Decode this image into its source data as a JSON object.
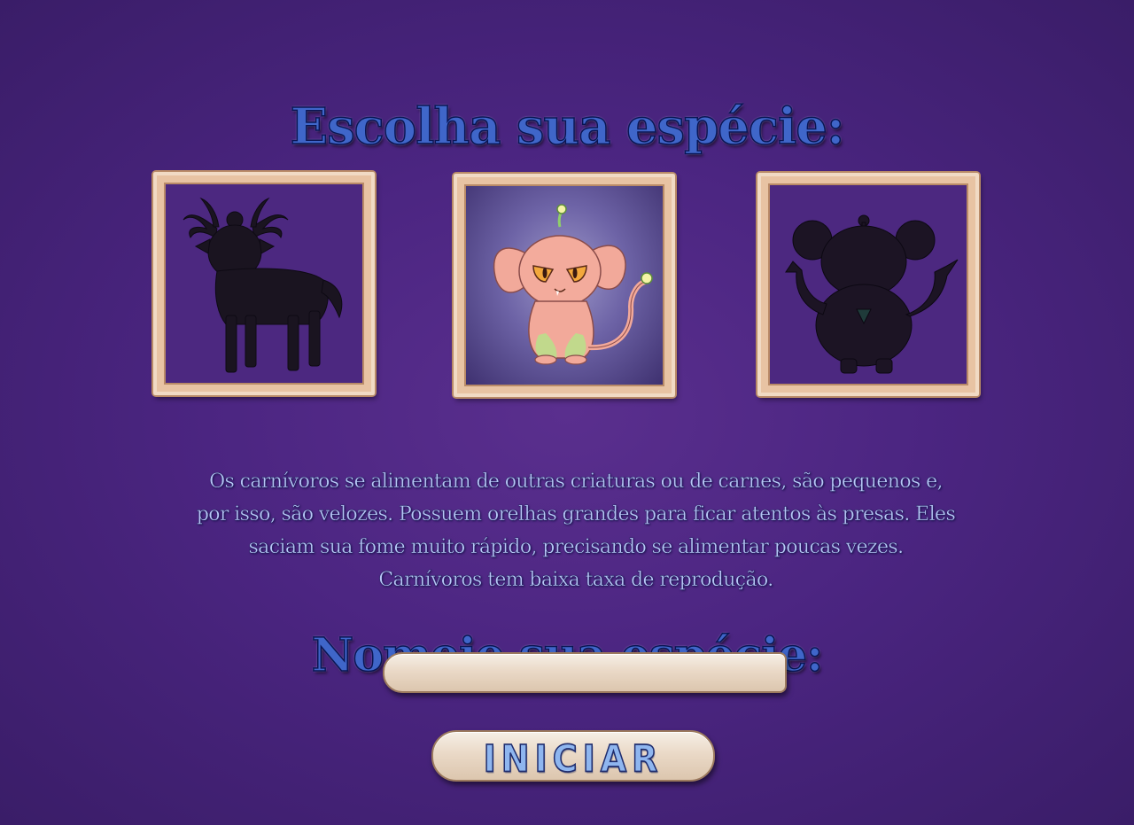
{
  "screen": {
    "title": "Escolha sua espécie:",
    "name_title": "Nomeie sua espécie:"
  },
  "species": [
    {
      "icon": "antlered-goat-silhouette",
      "selected": false
    },
    {
      "icon": "pink-eared-cat-creature",
      "selected": true
    },
    {
      "icon": "round-eared-monkey-silhouette",
      "selected": false
    }
  ],
  "description": "Os carnívoros se alimentam de outras criaturas ou de carnes, são pequenos e, por isso, são velozes. Possuem orelhas grandes para ficar atentos às presas. Eles saciam sua fome muito rápido, precisando se alimentar poucas vezes. Carnívoros tem baixa taxa de reprodução.",
  "name_input": {
    "value": "",
    "placeholder": ""
  },
  "start_button": {
    "label": "INICIAR"
  },
  "colors": {
    "background": "#4b2581",
    "title": "#3f66c9",
    "description_text": "#b9c7f7",
    "frame_wood": "#e8c3a3",
    "stick_wood": "#ead9c7"
  }
}
